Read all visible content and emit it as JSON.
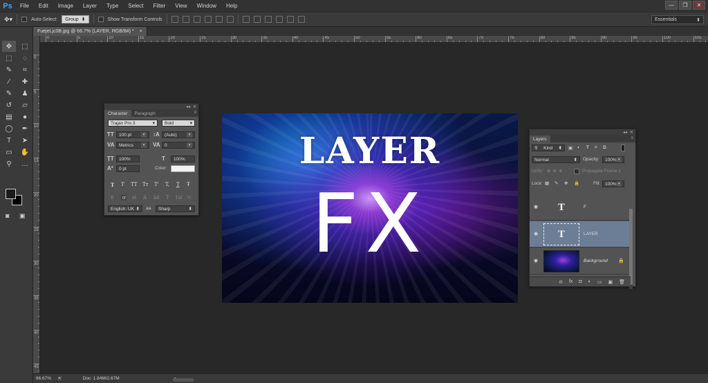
{
  "app": {
    "logo": "Ps",
    "menu": [
      "File",
      "Edit",
      "Image",
      "Layer",
      "Type",
      "Select",
      "Filter",
      "View",
      "Window",
      "Help"
    ],
    "window_controls": [
      "—",
      "❐",
      "✕"
    ]
  },
  "options_bar": {
    "auto_select_label": "Auto-Select:",
    "auto_select_value": "Group",
    "show_transform_label": "Show Transform Controls",
    "workspace": "Essentials"
  },
  "document": {
    "tab_title": "FuejeLjc0B.jpg @ 66.7% (LAYER, RGB/8#) *",
    "tab_close": "×",
    "ruler_top_labels": [
      "0",
      "5",
      "10",
      "15",
      "20",
      "25",
      "30",
      "35",
      "40",
      "45",
      "50",
      "55",
      "60",
      "65",
      "70",
      "75",
      "80",
      "85",
      "90",
      "95",
      "100",
      "105"
    ],
    "ruler_left_labels": [
      "0",
      "5",
      "10",
      "15",
      "20",
      "25",
      "30",
      "35",
      "40",
      "45"
    ]
  },
  "artwork": {
    "title_text": "LAYER",
    "big_text": "FX"
  },
  "character_panel": {
    "tabs": [
      "Character",
      "Paragraph"
    ],
    "font_family": "Trajan Pro 3",
    "font_style": "Bold",
    "font_size": "100 pt",
    "leading": "(Auto)",
    "kerning": "Metrics",
    "tracking": "0",
    "vertical_scale": "100%",
    "horizontal_scale": "100%",
    "baseline_shift": "0 pt",
    "color_label": "Color:",
    "language": "English: UK",
    "antialias": "Sharp",
    "type_buttons": [
      "T",
      "T",
      "TT",
      "Tт",
      "T'",
      "T,",
      "T",
      "Ŧ"
    ],
    "ot_buttons": [
      "fi",
      "ơ",
      "st",
      "A",
      "ād",
      "T",
      "1st",
      "½"
    ]
  },
  "layers_panel": {
    "tab": "Layers",
    "kind_label": "Kind",
    "blend_mode": "Normal",
    "opacity_label": "Opacity:",
    "opacity_value": "100%",
    "unify_label": "Unify:",
    "propagate_label": "Propagate Frame 1",
    "lock_label": "Lock:",
    "fill_label": "Fill:",
    "fill_value": "100%",
    "layers": [
      {
        "name": "F",
        "thumb": "T",
        "type": "text"
      },
      {
        "name": "LAYER",
        "thumb": "T",
        "type": "text"
      },
      {
        "name": "Background",
        "thumb": "",
        "type": "image"
      }
    ],
    "bottom_icons": [
      "⊝",
      "fx",
      "◘",
      "◐",
      "▭",
      "▣",
      "🗑"
    ]
  },
  "status_bar": {
    "zoom": "66.67%",
    "doc_info": "Doc: 1.84M/2.67M"
  }
}
